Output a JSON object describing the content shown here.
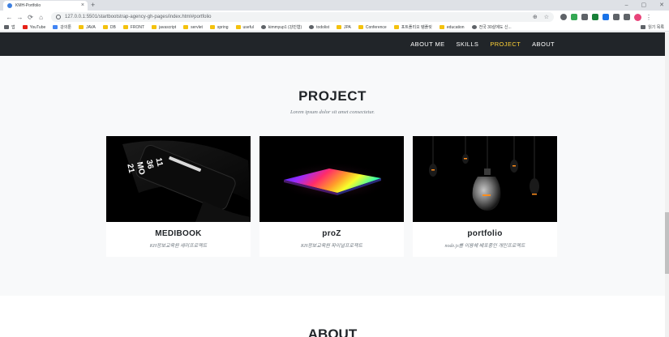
{
  "browser": {
    "tab_title": "KMH-Portfolio",
    "tab_close": "×",
    "new_tab": "+",
    "window_controls": [
      "–",
      "▢",
      "✕"
    ],
    "nav_buttons": [
      "←",
      "→",
      "⟳",
      "⌂"
    ],
    "url": "127.0.0.1:5501/startbootstrap-agency-gh-pages/index.html#portfolio",
    "omni_actions": [
      "⊕",
      "☆"
    ],
    "menu": "⋮",
    "bookmarks": [
      {
        "label": "앱",
        "icon": "apps-grid-icon"
      },
      {
        "label": "YouTube",
        "icon": "youtube-icon"
      },
      {
        "label": "강의툰",
        "icon": "site-icon"
      },
      {
        "label": "JAVA",
        "icon": "folder-icon"
      },
      {
        "label": "DB",
        "icon": "folder-icon"
      },
      {
        "label": "FRONT",
        "icon": "folder-icon"
      },
      {
        "label": "javascript",
        "icon": "folder-icon"
      },
      {
        "label": "servlet",
        "icon": "folder-icon"
      },
      {
        "label": "spring",
        "icon": "folder-icon"
      },
      {
        "label": "useful",
        "icon": "folder-icon"
      },
      {
        "label": "kimmyup1 (강민협)",
        "icon": "github-icon"
      },
      {
        "label": "todolist",
        "icon": "globe-icon"
      },
      {
        "label": "JPA",
        "icon": "folder-icon"
      },
      {
        "label": "Conference",
        "icon": "folder-icon"
      },
      {
        "label": "포트폴리오 템플릿",
        "icon": "folder-icon"
      },
      {
        "label": "education",
        "icon": "folder-icon"
      },
      {
        "label": "전국 30살에도 신...",
        "icon": "globe-icon"
      }
    ],
    "reading_list": "읽기 목록"
  },
  "nav": {
    "items": [
      "ABOUT ME",
      "SKILLS",
      "PROJECT",
      "ABOUT"
    ],
    "active": "PROJECT",
    "accent_color": "#fed136"
  },
  "project": {
    "heading": "PROJECT",
    "subheading": "Lorem ipsum dolor sit amet consectetur.",
    "cards": [
      {
        "title": "MEDIBOOK",
        "description": "KH정보교육원 세미프로젝트"
      },
      {
        "title": "proZ",
        "description": "KH정보교육원 파이널프로젝트"
      },
      {
        "title": "portfolio",
        "description": "node.js를 이용해 배포중인 개인프로젝트"
      }
    ]
  },
  "about": {
    "heading": "ABOUT"
  }
}
